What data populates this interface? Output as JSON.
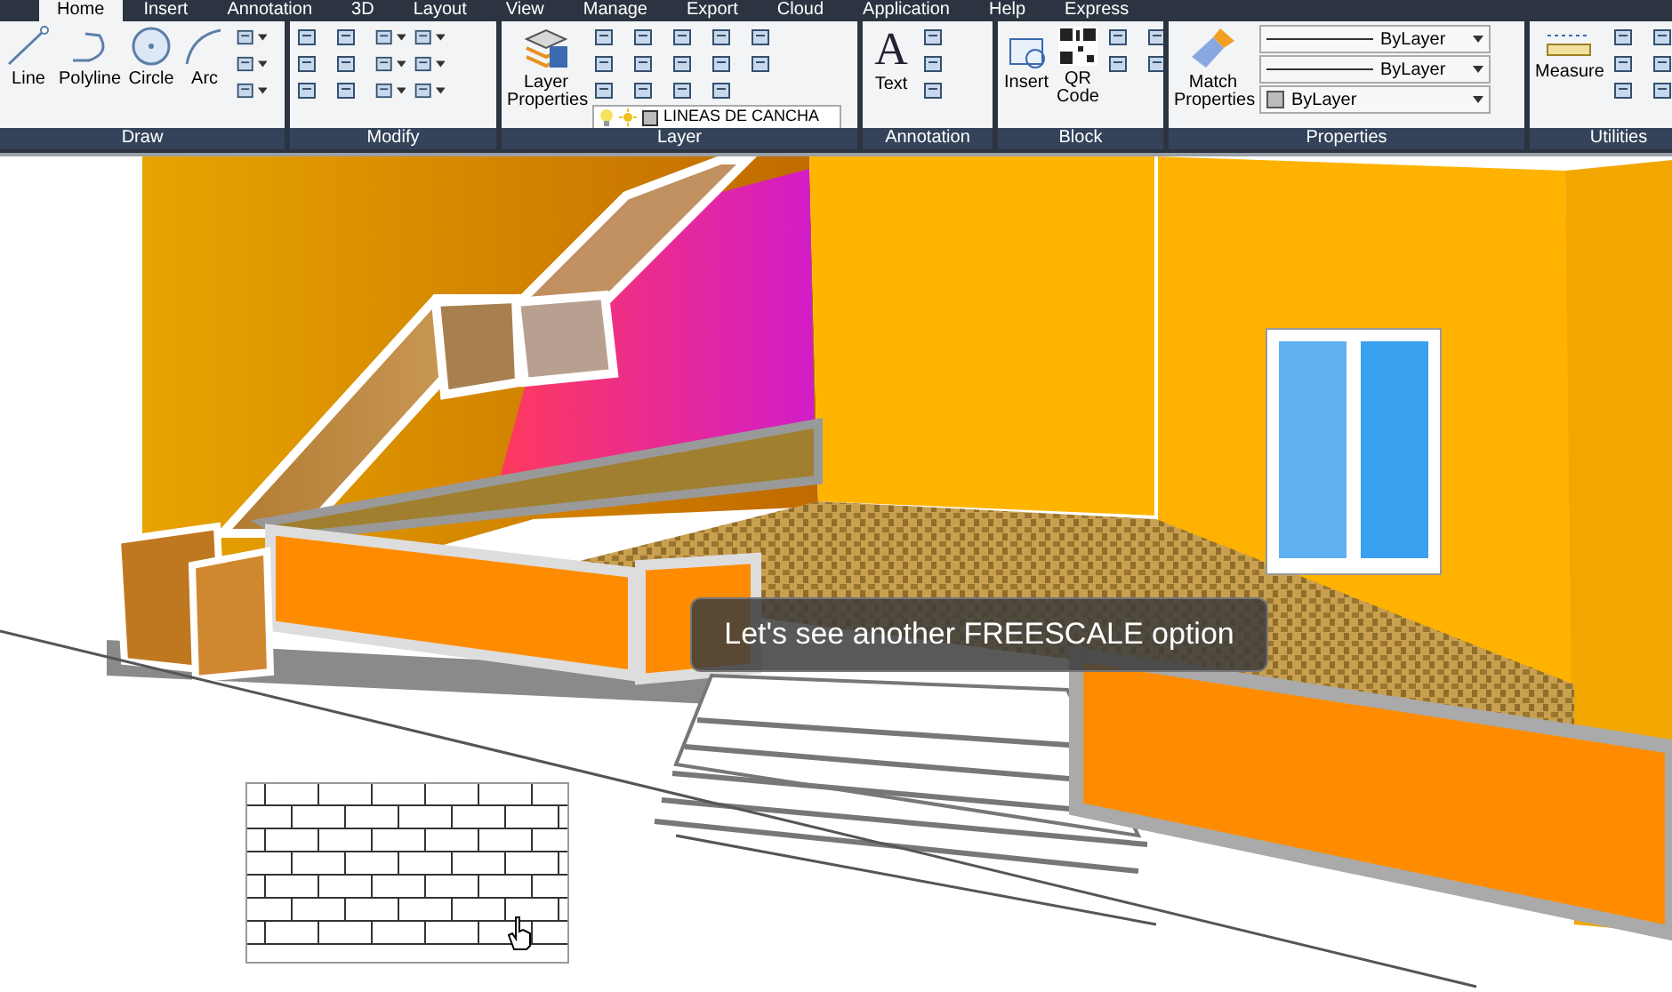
{
  "tabs": [
    {
      "label": "Home",
      "selected": true
    },
    {
      "label": "Insert",
      "selected": false
    },
    {
      "label": "Annotation",
      "selected": false
    },
    {
      "label": "3D",
      "selected": false
    },
    {
      "label": "Layout",
      "selected": false
    },
    {
      "label": "View",
      "selected": false
    },
    {
      "label": "Manage",
      "selected": false
    },
    {
      "label": "Export",
      "selected": false
    },
    {
      "label": "Cloud",
      "selected": false
    },
    {
      "label": "Application",
      "selected": false
    },
    {
      "label": "Help",
      "selected": false
    },
    {
      "label": "Express",
      "selected": false
    }
  ],
  "panels": [
    {
      "kind": "draw",
      "title": "Draw",
      "tools": [
        "Line",
        "Polyline",
        "Circle",
        "Arc"
      ]
    },
    {
      "kind": "modify",
      "title": "Modify"
    },
    {
      "kind": "layer",
      "title": "Layer",
      "tools": [
        "Layer Properties"
      ],
      "layer_value": "LINEAS DE CANCHA"
    },
    {
      "kind": "annotation",
      "title": "Annotation",
      "tools": [
        "Text"
      ],
      "glyph": "A"
    },
    {
      "kind": "block",
      "title": "Block",
      "tools": [
        "Insert",
        "QR Code"
      ]
    },
    {
      "kind": "properties",
      "title": "Properties",
      "tools": [
        "Match Properties"
      ],
      "dropdowns": [
        "ByLayer",
        "ByLayer",
        "ByLayer"
      ]
    },
    {
      "kind": "utilities",
      "title": "Utilities",
      "tools": [
        "Measure"
      ]
    }
  ],
  "caption": "Let's see another FREESCALE option"
}
